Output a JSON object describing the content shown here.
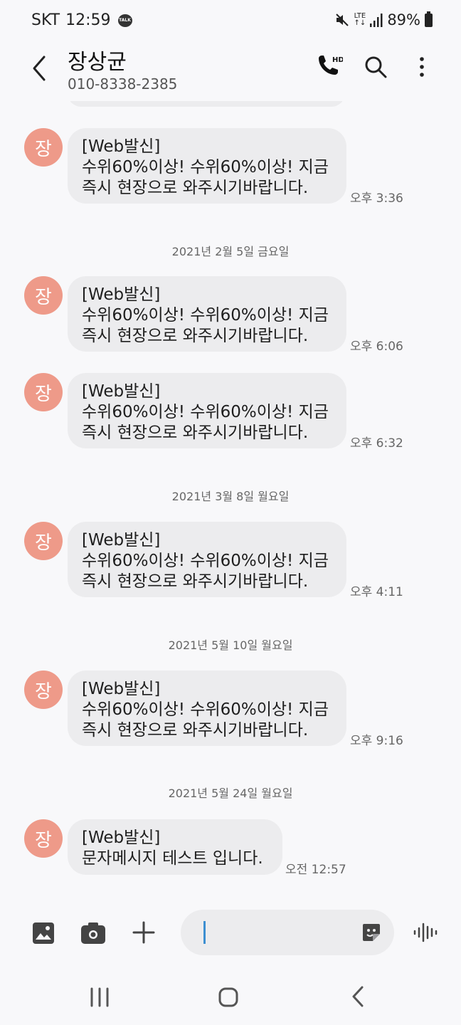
{
  "status_bar": {
    "carrier": "SKT",
    "time": "12:59",
    "talk_badge": "TALK",
    "network": "LTE",
    "battery": "89%"
  },
  "header": {
    "contact_name": "장상균",
    "phone_number": "010-8338-2385",
    "call_badge": "HD"
  },
  "avatar_letter": "장",
  "messages": [
    {
      "line1": "[Web발신]",
      "line2": "수위60%이상! 수위60%이상! 지금",
      "line3": "즉시 현장으로 와주시기바랍니다.",
      "time": "오후 3:36"
    },
    {
      "line1": "[Web발신]",
      "line2": "수위60%이상! 수위60%이상! 지금",
      "line3": "즉시 현장으로 와주시기바랍니다.",
      "time": "오후 6:06"
    },
    {
      "line1": "[Web발신]",
      "line2": "수위60%이상! 수위60%이상! 지금",
      "line3": "즉시 현장으로 와주시기바랍니다.",
      "time": "오후 6:32"
    },
    {
      "line1": "[Web발신]",
      "line2": "수위60%이상! 수위60%이상! 지금",
      "line3": "즉시 현장으로 와주시기바랍니다.",
      "time": "오후 4:11"
    },
    {
      "line1": "[Web발신]",
      "line2": "수위60%이상! 수위60%이상! 지금",
      "line3": "즉시 현장으로 와주시기바랍니다.",
      "time": "오후 9:16"
    },
    {
      "line1": "[Web발신]",
      "line2": "문자메시지 테스트 입니다.",
      "time": "오전 12:57"
    }
  ],
  "date_dividers": [
    "2021년 2월 5일 금요일",
    "2021년 3월 8일 월요일",
    "2021년 5월 10일 월요일",
    "2021년 5월 24일 월요일"
  ],
  "composer": {
    "value": "",
    "placeholder": ""
  },
  "icons": {
    "back": "back-arrow-icon",
    "call": "hd-call-icon",
    "search": "search-icon",
    "more": "more-vertical-icon",
    "gallery": "gallery-icon",
    "camera": "camera-icon",
    "attach": "plus-icon",
    "sticker": "sticker-icon",
    "voice": "voice-recorder-icon"
  },
  "colors": {
    "avatar": "#ee9a89",
    "bubble": "#ececee",
    "background": "#f8f8fa",
    "caret": "#3d8fd1"
  }
}
